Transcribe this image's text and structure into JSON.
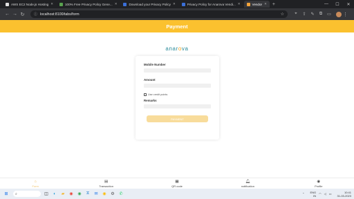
{
  "browser": {
    "tabs": [
      {
        "label": "AWS EC2 Node.js Hosting",
        "color": "#e0e0e0"
      },
      {
        "label": "100% Free Privacy Policy Gene...",
        "color": "#59a14f"
      },
      {
        "label": "Download your Privacy Policy",
        "color": "#3a6fd8"
      },
      {
        "label": "Privacy Policy for Anarova Vendi...",
        "color": "#3a6fd8"
      },
      {
        "label": "Vendor",
        "color": "#f2a33a"
      }
    ],
    "url": "localhost:8100/tabs/form"
  },
  "app": {
    "title": "Payment",
    "logo": {
      "prefix": "anar",
      "o": "o",
      "suffix": "va"
    },
    "form": {
      "mobile_label": "Mobile Number",
      "amount_label": "Amount",
      "checkbox_label": "Use credit points",
      "remarks_label": "Remarks",
      "submit_label": "PAYMENT"
    },
    "nav": [
      {
        "label": "Form",
        "icon": "home-icon",
        "active": true
      },
      {
        "label": "Transaction",
        "icon": "wallet-icon"
      },
      {
        "label": "QR code",
        "icon": "qr-code-icon"
      },
      {
        "label": "notification",
        "icon": "bell-icon"
      },
      {
        "label": "Profile",
        "icon": "profile-icon"
      }
    ]
  },
  "taskbar": {
    "lang": "ENG",
    "region": "IN",
    "time": "10:41",
    "date": "31-03-2023"
  }
}
